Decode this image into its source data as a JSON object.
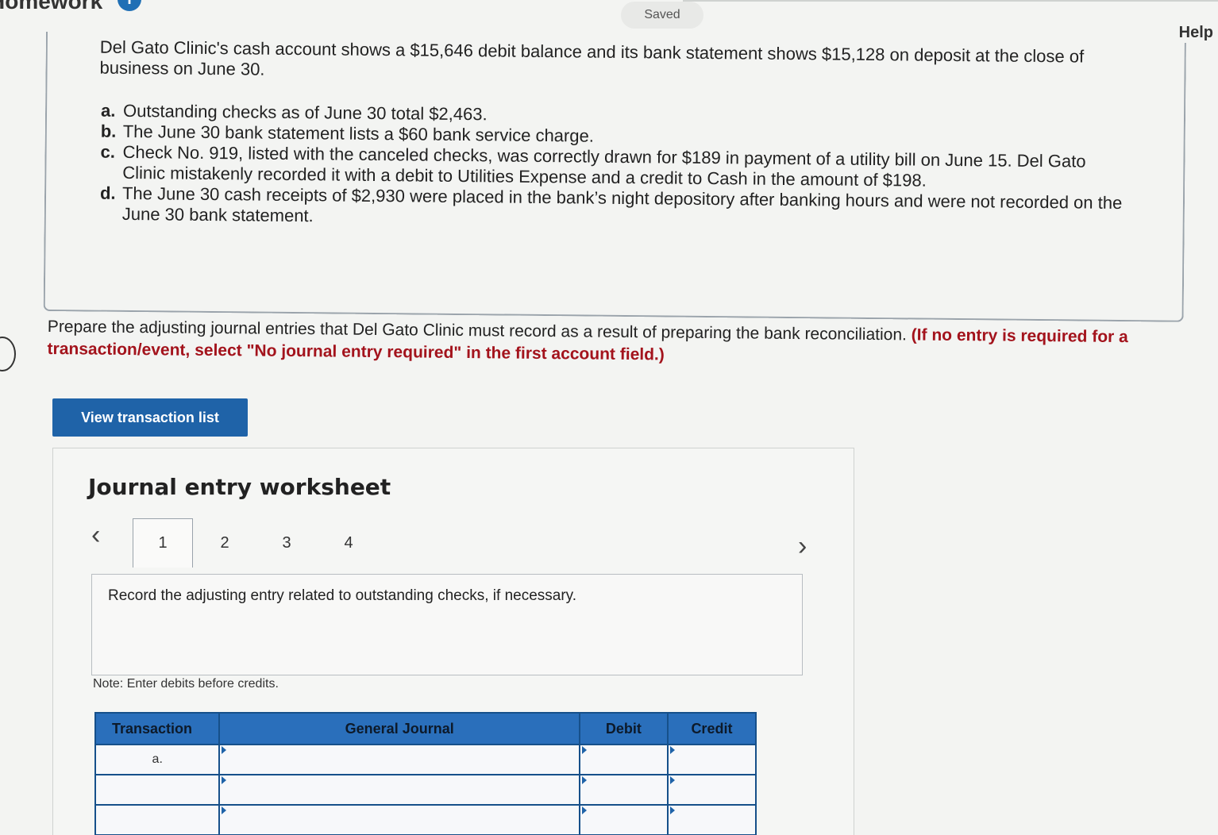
{
  "header": {
    "app_title": "Homework",
    "info_badge": "i",
    "saved_status": "Saved",
    "help_label": "Help"
  },
  "problem": {
    "intro": "Del Gato Clinic's cash account shows a $15,646 debit balance and its bank statement shows $15,128 on deposit at the close of business on June 30.",
    "items": [
      {
        "label": "a.",
        "text": "Outstanding checks as of June 30 total $2,463."
      },
      {
        "label": "b.",
        "text": "The June 30 bank statement lists a $60 bank service charge."
      },
      {
        "label": "c.",
        "text": "Check No. 919, listed with the canceled checks, was correctly drawn for $189 in payment of a utility bill on June 15. Del Gato Clinic mistakenly recorded it with a debit to Utilities Expense and a credit to Cash in the amount of $198."
      },
      {
        "label": "d.",
        "text": "The June 30 cash receipts of $2,930 were placed in the bank’s night depository after banking hours and were not recorded on the June 30 bank statement."
      }
    ]
  },
  "instruction": {
    "text": "Prepare the adjusting journal entries that Del Gato Clinic must record as a result of preparing the bank reconciliation.",
    "emphasis": "(If no entry is required for a transaction/event, select \"No journal entry required\" in the first account field.)"
  },
  "buttons": {
    "view_transaction_list": "View transaction list"
  },
  "worksheet": {
    "title": "Journal entry worksheet",
    "prev_icon": "‹",
    "next_icon": "›",
    "tabs": [
      "1",
      "2",
      "3",
      "4"
    ],
    "active_tab": "1",
    "prompt": "Record the adjusting entry related to outstanding checks, if necessary.",
    "note": "Note: Enter debits before credits.",
    "table": {
      "headers": [
        "Transaction",
        "General Journal",
        "Debit",
        "Credit"
      ],
      "rows": [
        {
          "transaction": "a."
        },
        {
          "transaction": ""
        },
        {
          "transaction": ""
        }
      ]
    }
  },
  "colors": {
    "accent_blue": "#1f63a8",
    "table_header_blue": "#2a6fbb",
    "emphasis_red": "#a3131c"
  }
}
